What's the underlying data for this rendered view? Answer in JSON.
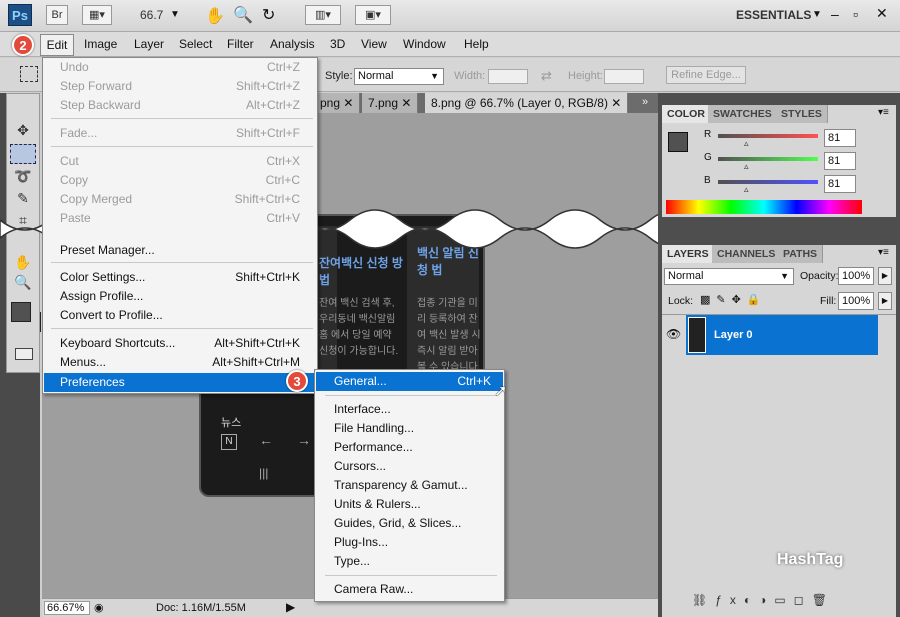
{
  "appbar": {
    "logo": "Ps",
    "bridge": "Br",
    "zoom": "66.7",
    "workspace": "ESSENTIALS"
  },
  "menubar": [
    "Edit",
    "Image",
    "Layer",
    "Select",
    "Filter",
    "Analysis",
    "3D",
    "View",
    "Window",
    "Help"
  ],
  "options": {
    "style_label": "Style:",
    "style_value": "Normal",
    "width_label": "Width:",
    "height_label": "Height:",
    "refine_edge": "Refine Edge..."
  },
  "doc_tabs": [
    "png",
    "7.png",
    "8.png @ 66.7% (Layer 0, RGB/8)"
  ],
  "edit_menu": [
    {
      "label": "Undo",
      "shortcut": "Ctrl+Z"
    },
    {
      "label": "Step Forward",
      "shortcut": "Shift+Ctrl+Z"
    },
    {
      "label": "Step Backward",
      "shortcut": "Alt+Ctrl+Z"
    },
    {
      "label": "Fade...",
      "shortcut": "Shift+Ctrl+F"
    },
    {
      "label": "Cut",
      "shortcut": "Ctrl+X"
    },
    {
      "label": "Copy",
      "shortcut": "Ctrl+C"
    },
    {
      "label": "Copy Merged",
      "shortcut": "Shift+Ctrl+C"
    },
    {
      "label": "Paste",
      "shortcut": "Ctrl+V"
    },
    {
      "label": "Preset Manager...",
      "shortcut": ""
    },
    {
      "label": "Color Settings...",
      "shortcut": "Shift+Ctrl+K"
    },
    {
      "label": "Assign Profile...",
      "shortcut": ""
    },
    {
      "label": "Convert to Profile...",
      "shortcut": ""
    },
    {
      "label": "Keyboard Shortcuts...",
      "shortcut": "Alt+Shift+Ctrl+K"
    },
    {
      "label": "Menus...",
      "shortcut": "Alt+Shift+Ctrl+M"
    },
    {
      "label": "Preferences",
      "shortcut": ""
    }
  ],
  "prefs_submenu": [
    {
      "label": "General...",
      "shortcut": "Ctrl+K"
    },
    {
      "label": "Interface...",
      "shortcut": ""
    },
    {
      "label": "File Handling...",
      "shortcut": ""
    },
    {
      "label": "Performance...",
      "shortcut": ""
    },
    {
      "label": "Cursors...",
      "shortcut": ""
    },
    {
      "label": "Transparency & Gamut...",
      "shortcut": ""
    },
    {
      "label": "Units & Rulers...",
      "shortcut": ""
    },
    {
      "label": "Guides, Grid, & Slices...",
      "shortcut": ""
    },
    {
      "label": "Plug-Ins...",
      "shortcut": ""
    },
    {
      "label": "Type...",
      "shortcut": ""
    },
    {
      "label": "Camera Raw...",
      "shortcut": ""
    }
  ],
  "badges": {
    "edit": "2",
    "general": "3"
  },
  "color_panel": {
    "tabs": [
      "COLOR",
      "SWATCHES",
      "STYLES"
    ],
    "channels": [
      {
        "label": "R",
        "value": "81"
      },
      {
        "label": "G",
        "value": "81"
      },
      {
        "label": "B",
        "value": "81"
      }
    ]
  },
  "layers_panel": {
    "tabs": [
      "LAYERS",
      "CHANNELS",
      "PATHS"
    ],
    "blend_mode": "Normal",
    "opacity_label": "Opacity:",
    "opacity": "100%",
    "lock_label": "Lock:",
    "fill_label": "Fill:",
    "fill": "100%",
    "layer_name": "Layer 0"
  },
  "phone": {
    "col1_title": "잔여백신 신청 방법",
    "col1_body": "잔여 백신 검색 후, 우리동네 백신알림 홈 에서 당일 예약 신청이 가능합니다.",
    "col2_title": "백신 알림 신청 법",
    "col2_body": "접종 기관을 미리 등록하여 잔여 백신 발생 시 즉시 알림 받아 볼 수 있습니다.",
    "news": "뉴스"
  },
  "status": {
    "zoom": "66.67%",
    "doc": "Doc: 1.16M/1.55M"
  },
  "watermark": "HashTag"
}
